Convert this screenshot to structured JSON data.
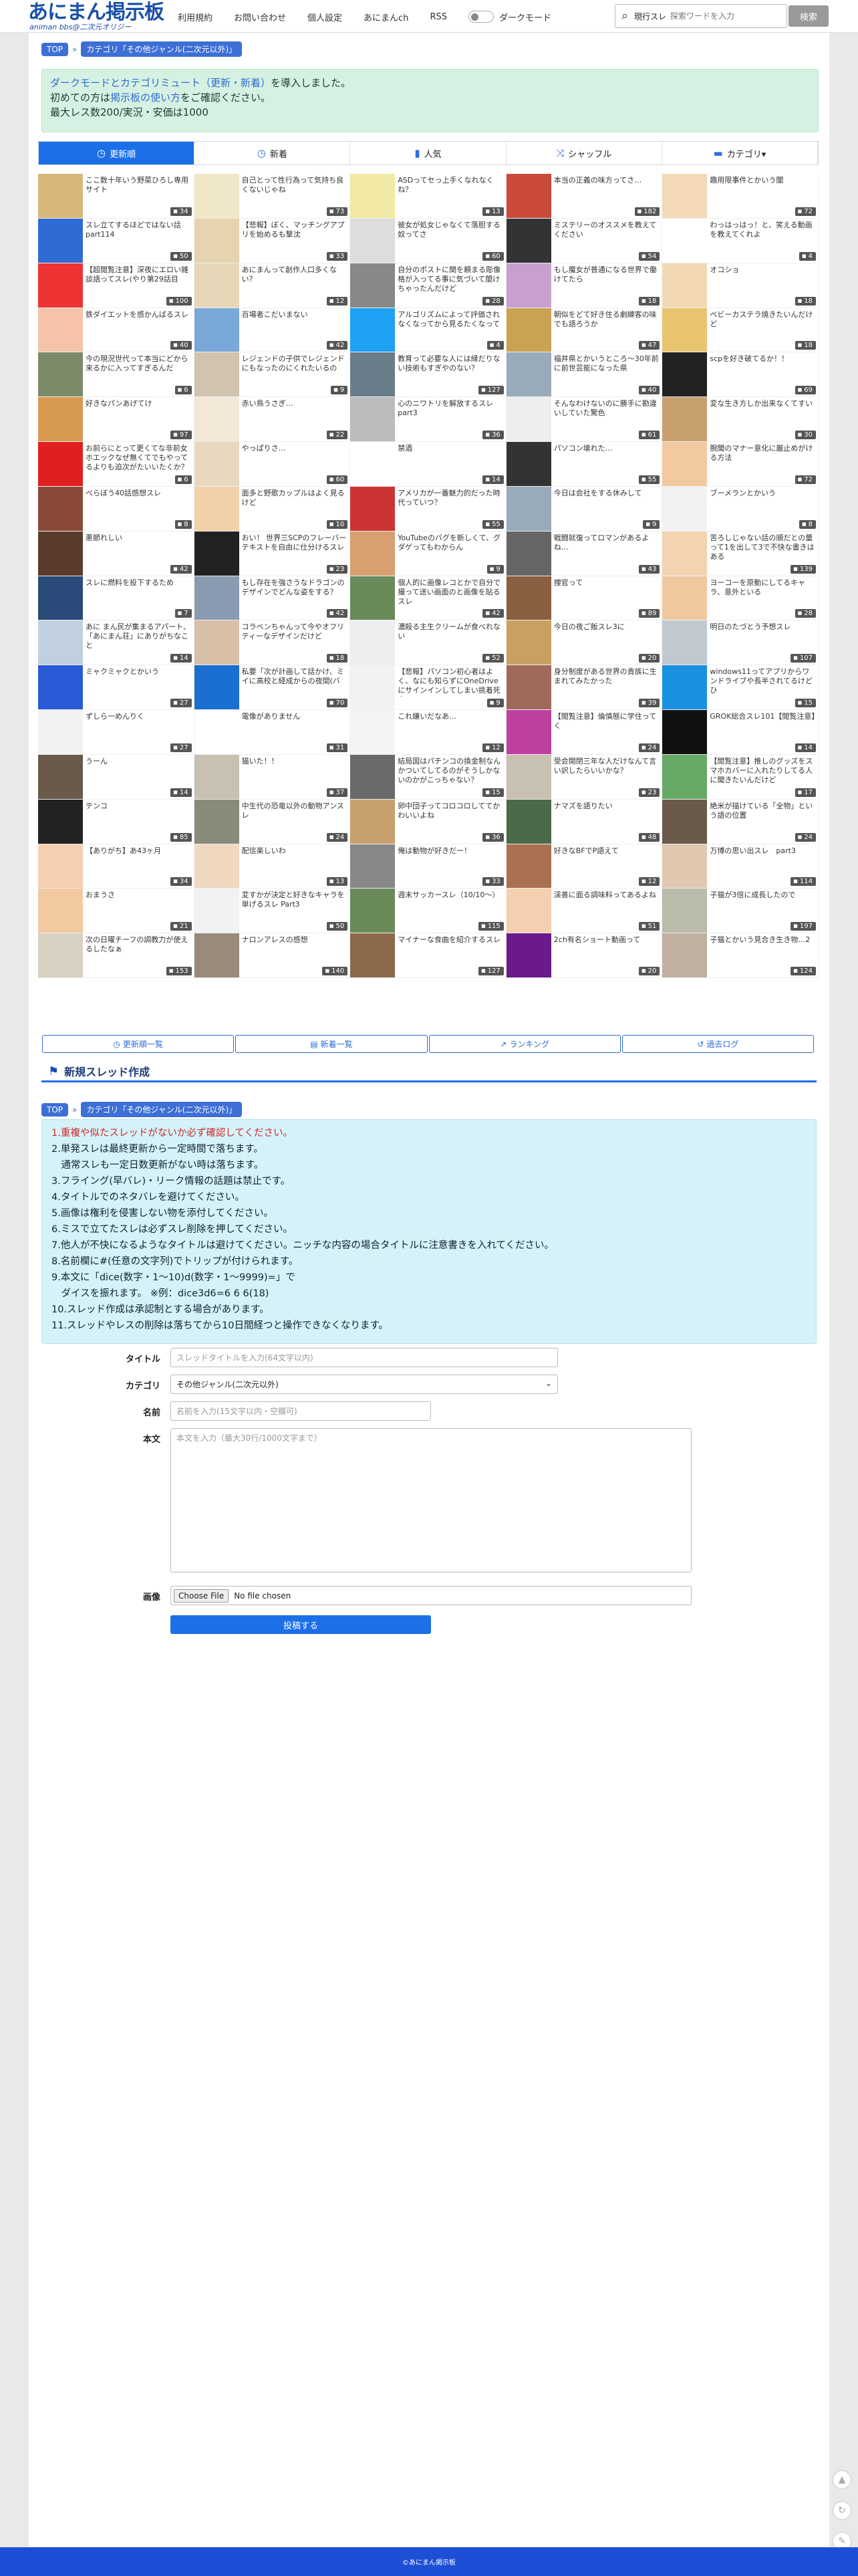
{
  "header": {
    "logo_title": "あにまん掲示板",
    "logo_sub": "animan bbs@二次元オリジー",
    "nav": [
      "利用規約",
      "お問い合わせ",
      "個人設定",
      "あにまんch",
      "RSS"
    ],
    "dark_mode_label": "ダークモード",
    "search_select": "現行スレ",
    "search_placeholder": "探索ワードを入力",
    "search_button": "検索"
  },
  "breadcrumb": {
    "top": "TOP",
    "category": "カテゴリ「その他ジャンル(二次元以外)」"
  },
  "notice": {
    "line1_hl": "ダークモードとカテゴリミュート（更新・新着）",
    "line1_rest": "を導入しました。",
    "line2_a": "初めての方は",
    "line2_hl": "掲示板の使い方",
    "line2_b": "をご確認ください。",
    "line3": "最大レス数200/実況・安価は1000"
  },
  "tabs": [
    {
      "icon": "clock-icon",
      "glyph": "◷",
      "label": "更新順",
      "active": true
    },
    {
      "icon": "clock-icon",
      "glyph": "◷",
      "label": "新着",
      "active": false
    },
    {
      "icon": "bar-chart-icon",
      "glyph": "▮",
      "label": "人気",
      "active": false
    },
    {
      "icon": "shuffle-icon",
      "glyph": "⤨",
      "label": "シャッフル",
      "active": false
    },
    {
      "icon": "folder-icon",
      "glyph": "▬",
      "label": "カテゴリ▾",
      "active": false
    }
  ],
  "threads": [
    {
      "t": "ここ数十年いう野菜ひろし専用サイト",
      "c": "34",
      "th": "#d8b77a"
    },
    {
      "t": "自己とって性行為って気持ち良くないじゃね",
      "c": "73",
      "th": "#f0e6c8"
    },
    {
      "t": "ASDってセっ上手くなれなくね？",
      "c": "13",
      "th": "#f2e9a4"
    },
    {
      "t": "本当の正義の味方ってさ…",
      "c": "182",
      "th": "#c94a3a"
    },
    {
      "t": "趣用限事件とかいう闇",
      "c": "72",
      "th": "#f3d9b8"
    },
    {
      "t": "スレ立てするほどではない話part114",
      "c": "50",
      "th": "#2f6bd3"
    },
    {
      "t": "【悲報】ぼく、マッチングアプリを始めるも撃沈",
      "c": "33",
      "th": "#e6d3b0"
    },
    {
      "t": "彼女が処女じゃなくて落胆する奴ってさ",
      "c": "60",
      "th": "#ddd"
    },
    {
      "t": "ミステリーのオススメを教えてください",
      "c": "54",
      "th": "#333"
    },
    {
      "t": "わっはっはっ！と、笑える動画を教えてくれよ",
      "c": "4",
      "th": "#fff"
    },
    {
      "t": "【超閲覧注意】深夜にエロい雑談語ってスレ(やり第29話目",
      "c": "100",
      "th": "#e33"
    },
    {
      "t": "あにまんって創作人口多くない？",
      "c": "12",
      "th": "#e8d6b8"
    },
    {
      "t": "自分のポストに関を頼まる彫像格が入ってる事に気づいて闇けちゃったんだけど",
      "c": "28",
      "th": "#888"
    },
    {
      "t": "もし魔女が普通になる世界で働けてたら",
      "c": "18",
      "th": "#c8a0d0"
    },
    {
      "t": "オコショ",
      "c": "18",
      "th": "#f2d9b3"
    },
    {
      "t": "鉄ダイエットを感かんばるスレ",
      "c": "40",
      "th": "#f4c3a8"
    },
    {
      "t": "百場者こだいまない",
      "c": "42",
      "th": "#7aa8d8"
    },
    {
      "t": "アルゴリズムによって評価されなくなってから見るたくなって",
      "c": "4",
      "th": "#1da1f2"
    },
    {
      "t": "朝似をどて好き住る劇練客の味でも語ろうか",
      "c": "47",
      "th": "#c9a253"
    },
    {
      "t": "ベビーカステラ焼きたいんだけど",
      "c": "18",
      "th": "#e9c470"
    },
    {
      "t": "今の現況世代って本当にどから来るかに入ってすぎるんだ",
      "c": "6",
      "th": "#7c8a6a"
    },
    {
      "t": "レジェンドの子供でレジェンドにもなったのにくれたいるの",
      "c": "9",
      "th": "#d0c4b0"
    },
    {
      "t": "教育って必要な人には縁だりない技術もすぎやのない？",
      "c": "127",
      "th": "#6a7d8a"
    },
    {
      "t": "福井県とかいうところ～30年前に前世芸能になった県",
      "c": "40",
      "th": "#9ab"
    },
    {
      "t": "scpを好き破てるか！！",
      "c": "69",
      "th": "#222"
    },
    {
      "t": "好きなパンあげてけ",
      "c": "97",
      "th": "#d89a50"
    },
    {
      "t": "赤い鳥うさぎ…",
      "c": "22",
      "th": "#f3e8d8"
    },
    {
      "t": "心のニワトリを解放するスレpart3",
      "c": "36",
      "th": "#bbb"
    },
    {
      "t": "そんなわけないのに勝手に勘違いしていた驚色",
      "c": "61",
      "th": "#eee"
    },
    {
      "t": "変な生き方しか出来なくてすい",
      "c": "30",
      "th": "#c8a070"
    },
    {
      "t": "お前らにとって更くてな非前女ホエックなぜ無くてでもやってるよりも迫次がたいいたくか？",
      "c": "6",
      "th": "#e02020"
    },
    {
      "t": "やっぱりさ…",
      "c": "60",
      "th": "#e8d8c0"
    },
    {
      "t": "禁酒",
      "c": "14",
      "th": "#fff"
    },
    {
      "t": "パソコン壊れた…",
      "c": "55",
      "th": "#333"
    },
    {
      "t": "腕聞のマナー意化に厳止めがける方法",
      "c": "72",
      "th": "#f2c9a0"
    },
    {
      "t": "べらぼう40話感想スレ",
      "c": "8",
      "th": "#8a4a3a"
    },
    {
      "t": "面多と野歌カップルはよく見るけど",
      "c": "10",
      "th": "#f2d0a8"
    },
    {
      "t": "アメリカが一番魅力的だった時代っていつ？",
      "c": "55",
      "th": "#c33"
    },
    {
      "t": "今日は会社をする休みして",
      "c": "9",
      "th": "#9ab"
    },
    {
      "t": "ブーメランとかいう",
      "c": "8",
      "th": "#f2f2f2"
    },
    {
      "t": "悪節れしい",
      "c": "42",
      "th": "#5a3a2a"
    },
    {
      "t": "おい！ 世界三SCPのフレーバーテキストを自由に仕分けるスレ",
      "c": "23",
      "th": "#222"
    },
    {
      "t": "YouTubeのバグを新しくて、グダゲってもわからん",
      "c": "9",
      "th": "#d8a070"
    },
    {
      "t": "戦闘就復ってロマンがあるよね…",
      "c": "43",
      "th": "#666"
    },
    {
      "t": "苦ろしじゃない話の順だとの量って1を出して3で不快な書きはある",
      "c": "139",
      "th": "#f3d3b0"
    },
    {
      "t": "スレに燃料を投下するため",
      "c": "7",
      "th": "#2a4a7a"
    },
    {
      "t": "もし存在を強さうなドラゴンのデザインでどんな姿をする？",
      "c": "42",
      "th": "#8a9ab0"
    },
    {
      "t": "個人的に画像レコとかで自分で撮って送い画面のと画像を貼るスレ",
      "c": "42",
      "th": "#6a8a5a"
    },
    {
      "t": "捜官って",
      "c": "89",
      "th": "#8a6040"
    },
    {
      "t": "ヨーコーを原動にしてるキャラ、意外といる",
      "c": "28",
      "th": "#f0c8a0"
    },
    {
      "t": "あに まん民が集まるアパート、「あにまん荘」にありがちなこと",
      "c": "14",
      "th": "#c0d0e0"
    },
    {
      "t": "コラベンちゃんって今やオフリティーなデザインだけど",
      "c": "18",
      "th": "#d8c0a8"
    },
    {
      "t": "濃殺る主生クリームが食べれない",
      "c": "52",
      "th": "#eee"
    },
    {
      "t": "今日の夜ご飯スレ3に",
      "c": "20",
      "th": "#c8a060"
    },
    {
      "t": "明日のたづとう予想スレ",
      "c": "107",
      "th": "#c0c8d0"
    },
    {
      "t": "ミャクミャクとかいう",
      "c": "27",
      "th": "#2a5ad8"
    },
    {
      "t": "私要「次が計画して話かけ、ミイに高校と経成からの夜間(バ",
      "c": "70",
      "th": "#1a6fd0"
    },
    {
      "t": "【悲報】パソコン初心者はよく、なにも知らずにOneDriveにサインインしてしまい挑着死亡",
      "c": "9",
      "th": "#f2f2f2"
    },
    {
      "t": "身分制度がある世界の貴族に生まれてみたかった",
      "c": "39",
      "th": "#a06a5a"
    },
    {
      "t": "windows11ってアプリからワンドライブや長半されてるけど ひ",
      "c": "15",
      "th": "#1a90e0"
    },
    {
      "t": "ずしら一めんりく",
      "c": "27",
      "th": "#f2f2f2"
    },
    {
      "t": "電像がありません",
      "c": "31",
      "th": "#fff"
    },
    {
      "t": "これ嫌いだなあ…",
      "c": "12",
      "th": "#f4f4f4"
    },
    {
      "t": "【閲覧注意】倫慎態に学住ってく",
      "c": "24",
      "th": "#c040a0"
    },
    {
      "t": "GROK総合スレ101【閲覧注意】",
      "c": "14",
      "th": "#111"
    },
    {
      "t": "うーん",
      "c": "14",
      "th": "#6a5a4a"
    },
    {
      "t": "猫いた！！",
      "c": "37",
      "th": "#c8c0b0"
    },
    {
      "t": "結局国はパチンコの換金制なんかついてしてるのがそうしかないのかがこっちゃない？",
      "c": "15",
      "th": "#6a6a6a"
    },
    {
      "t": "受会開閉三年な人だけなんて言い訳したらいいかな？",
      "c": "23",
      "th": "#c8c0b0"
    },
    {
      "t": "【閲覧注意】推しのグッズをスマホカバーに入れたりしてる人に聞きたいんだけど",
      "c": "17",
      "th": "#6a6"
    },
    {
      "t": "テンコ",
      "c": "85",
      "th": "#222"
    },
    {
      "t": "中生代の恐竜以外の動物アンスレ",
      "c": "24",
      "th": "#8a8a7a"
    },
    {
      "t": "卵中団子ってコロコロしててかわいいよね",
      "c": "36",
      "th": "#c8a070"
    },
    {
      "t": "ナマズを語りたい",
      "c": "48",
      "th": "#4a6a4a"
    },
    {
      "t": "絶米が描けている「全物」という語の位置",
      "c": "24",
      "th": "#6a5a4a"
    },
    {
      "t": "【ありがち】あ43ヶ月",
      "c": "34",
      "th": "#f4d0b0"
    },
    {
      "t": "配信楽しいわ",
      "c": "13",
      "th": "#f0d8c0"
    },
    {
      "t": "俺は動物が好きだー！",
      "c": "33",
      "th": "#888"
    },
    {
      "t": "好きなBFでP語えて",
      "c": "12",
      "th": "#aa7050"
    },
    {
      "t": "万博の思い出スレ　part3",
      "c": "114",
      "th": "#e0c8b0"
    },
    {
      "t": "おまうさ",
      "c": "21",
      "th": "#f2c9a0"
    },
    {
      "t": "変すかが決定と好きなキャラを単げるスレ Part3",
      "c": "50",
      "th": "#f2f2f2"
    },
    {
      "t": "週末サッカースレ（10/10～）",
      "c": "115",
      "th": "#6a8a5a"
    },
    {
      "t": "渓善に面る調味料ってあるよね",
      "c": "51",
      "th": "#f4d0b0"
    },
    {
      "t": "子猫が3倍に成長したので",
      "c": "197",
      "th": "#bba"
    },
    {
      "t": "次の日曜チーフの調教力が使えるしたなぁ",
      "c": "153",
      "th": "#d8d0c0"
    },
    {
      "t": "ナロンアレスの感想",
      "c": "140",
      "th": "#9a8a7a"
    },
    {
      "t": "マイナーな食曲を紹介するスレ",
      "c": "127",
      "th": "#8a6a4a"
    },
    {
      "t": "2ch有名ショート動画って",
      "c": "20",
      "th": "#6a1a8a"
    },
    {
      "t": "子猫とかいう見合き生き物…2",
      "c": "124",
      "th": "#c0b0a0"
    }
  ],
  "links": [
    {
      "icon": "clock-icon",
      "glyph": "◷",
      "label": "更新順一覧"
    },
    {
      "icon": "list-icon",
      "glyph": "▤",
      "label": "新着一覧"
    },
    {
      "icon": "trend-icon",
      "glyph": "↗",
      "label": "ランキング"
    },
    {
      "icon": "history-icon",
      "glyph": "↺",
      "label": "過去ログ"
    }
  ],
  "new_thread": {
    "title": "新規スレッド作成",
    "rules": [
      "1.重複や似たスレッドがないか必ず確認してください。",
      "2.単発スレは最終更新から一定時間で落ちます。",
      "　通常スレも一定日数更新がない時は落ちます。",
      "3.フライング(早バレ)・リーク情報の話題は禁止です。",
      "4.タイトルでのネタバレを避けてください。",
      "5.画像は権利を侵害しない物を添付してください。",
      "6.ミスで立てたスレは必ずスレ削除を押してください。",
      "7.他人が不快になるようなタイトルは避けてください。ニッチな内容の場合タイトルに注意書きを入れてください。",
      "8.名前欄に#(任意の文字列)でトリップが付けられます。",
      "9.本文に「dice(数字・1～10)d(数字・1～9999)=」で",
      "　ダイスを振れます。 ※例：dice3d6=6 6 6(18)",
      "10.スレッド作成は承認制とする場合があります。",
      "11.スレッドやレスの削除は落ちてから10日間経つと操作できなくなります。"
    ],
    "form": {
      "title_label": "タイトル",
      "title_placeholder": "スレッドタイトルを入力(64文字以内)",
      "category_label": "カテゴリ",
      "category_value": "その他ジャンル(二次元以外)",
      "name_label": "名前",
      "name_placeholder": "名前を入力(15文字以内・空欄可)",
      "body_label": "本文",
      "body_placeholder": "本文を入力（最大30行/1000文字まで）",
      "image_label": "画像",
      "file_button": "Choose File",
      "file_status": "No file chosen",
      "submit": "投稿する"
    }
  },
  "footer": {
    "text": "©あにまん掲示板"
  }
}
